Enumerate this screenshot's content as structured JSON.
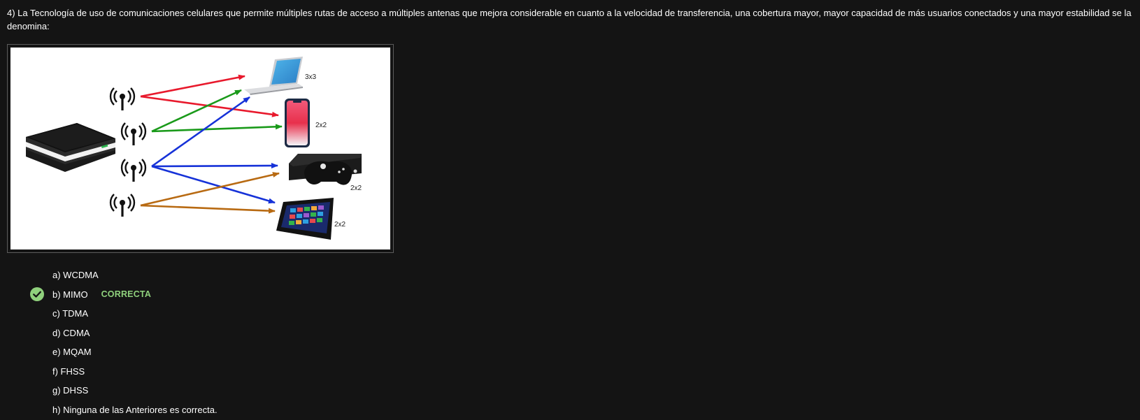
{
  "question": {
    "text": "4) La Tecnología de uso de comunicaciones celulares que permite múltiples rutas de acceso a múltiples antenas que mejora considerable en cuanto a la velocidad de transferencia, una cobertura mayor, mayor capacidad de más usuarios conectados y una mayor estabilidad se la denomina:"
  },
  "figure": {
    "device_labels": {
      "laptop": "3x3",
      "phone": "2x2",
      "console": "2x2",
      "tablet": "2x2"
    },
    "arrow_colors": {
      "red": "#e8192c",
      "green": "#1a9a1a",
      "blue": "#1632d8",
      "orange": "#b86a12"
    }
  },
  "options": [
    {
      "label": "a) WCDMA"
    },
    {
      "label": "b) MIMO",
      "badge": "CORRECTA"
    },
    {
      "label": "c) TDMA"
    },
    {
      "label": "d) CDMA"
    },
    {
      "label": "e) MQAM"
    },
    {
      "label": "f) FHSS"
    },
    {
      "label": "g) DHSS"
    },
    {
      "label": "h) Ninguna de las Anteriores es correcta."
    }
  ],
  "colors": {
    "background": "#141414",
    "correct": "#8fd07c",
    "check_icon": "#8fd07c"
  }
}
